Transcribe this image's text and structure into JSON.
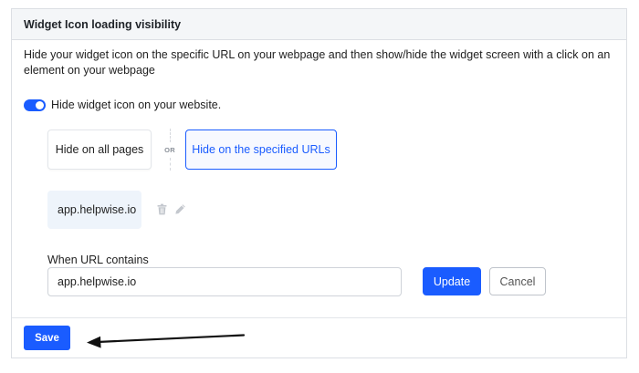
{
  "section": {
    "title": "Widget Icon loading visibility",
    "description": "Hide your widget icon on the specific URL on your webpage and then show/hide the widget screen with a click on an element on your webpage"
  },
  "toggle": {
    "label": "Hide widget icon on your website.",
    "enabled": true
  },
  "options": {
    "all_pages": "Hide on all pages",
    "separator": "OR",
    "specified_urls": "Hide on the specified URLs",
    "selected": "specified_urls"
  },
  "urls": [
    {
      "value": "app.helpwise.io",
      "icons": [
        "trash-icon",
        "pencil-icon"
      ]
    }
  ],
  "edit_form": {
    "label": "When URL contains",
    "value": "app.helpwise.io",
    "update_label": "Update",
    "cancel_label": "Cancel"
  },
  "footer": {
    "save_label": "Save"
  },
  "colors": {
    "accent": "#1a5cff",
    "header_bg": "#f4f6f8",
    "chip_bg": "#eef4fb"
  }
}
